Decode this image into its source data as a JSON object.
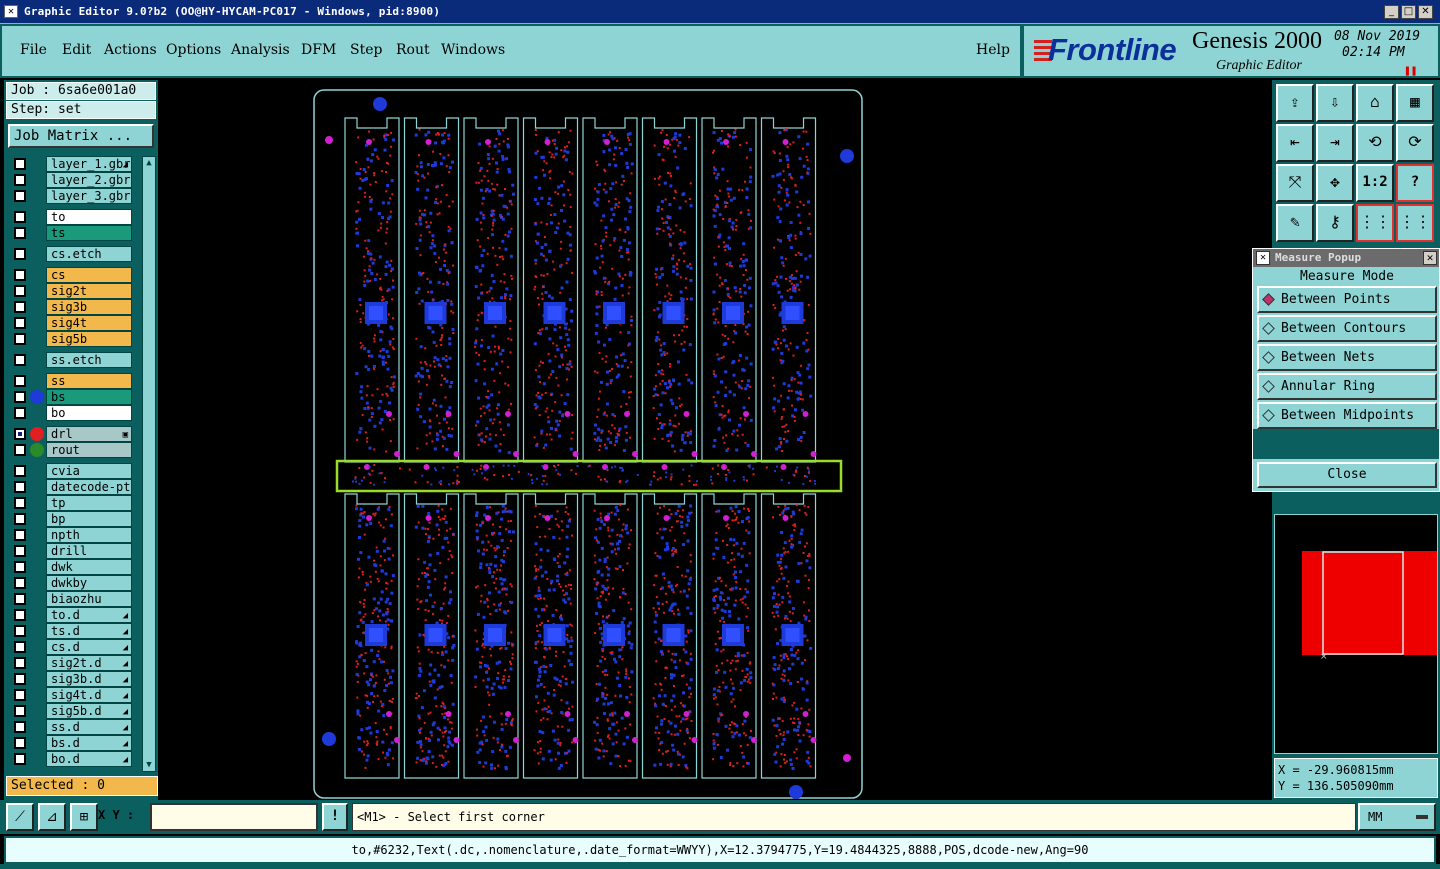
{
  "window": {
    "title": "Graphic Editor 9.0?b2 (OO@HY-HYCAM-PC017 - Windows, pid:8900)"
  },
  "menu": {
    "items": [
      "File",
      "Edit",
      "Actions",
      "Options",
      "Analysis",
      "DFM",
      "Step",
      "Rout",
      "Windows"
    ],
    "help": "Help"
  },
  "brand": {
    "logo": "Frontline",
    "product": "Genesis 2000",
    "subtitle": "Graphic Editor",
    "date": "08 Nov 2019",
    "time": "02:14 PM"
  },
  "job": {
    "job_label": "Job : 6sa6e001a0",
    "step_label": "Step: set",
    "job_matrix_button": "Job Matrix ..."
  },
  "layers": [
    {
      "name": "layer_1.gbr",
      "color": "#8fd4d4",
      "tag": "◢"
    },
    {
      "name": "layer_2.gbr",
      "color": "#8fd4d4",
      "tag": ""
    },
    {
      "name": "layer_3.gbr",
      "color": "#8fd4d4",
      "tag": ""
    },
    {
      "name": "to",
      "color": "#ffffff",
      "tag": ""
    },
    {
      "name": "ts",
      "color": "#1a9a7a",
      "tag": ""
    },
    {
      "name": "cs.etch",
      "color": "#8fd4d4",
      "tag": ""
    },
    {
      "name": "cs",
      "color": "#f2b84c",
      "tag": ""
    },
    {
      "name": "sig2t",
      "color": "#f2b84c",
      "tag": ""
    },
    {
      "name": "sig3b",
      "color": "#f2b84c",
      "tag": ""
    },
    {
      "name": "sig4t",
      "color": "#f2b84c",
      "tag": ""
    },
    {
      "name": "sig5b",
      "color": "#f2b84c",
      "tag": ""
    },
    {
      "name": "ss.etch",
      "color": "#8fd4d4",
      "tag": ""
    },
    {
      "name": "ss",
      "color": "#f2b84c",
      "tag": ""
    },
    {
      "name": "bs",
      "color": "#1a9a7a",
      "tag": "",
      "dot": "#1e3ad8"
    },
    {
      "name": "bo",
      "color": "#ffffff",
      "tag": ""
    },
    {
      "name": "drl",
      "color": "#a8c8c8",
      "tag": "▣",
      "dot": "#e02020",
      "checked": true
    },
    {
      "name": "rout",
      "color": "#a8c8c8",
      "tag": "",
      "dot": "#2a8a2a"
    },
    {
      "name": "cvia",
      "color": "#8fd4d4",
      "tag": ""
    },
    {
      "name": "datecode-ptc",
      "color": "#8fd4d4",
      "tag": ""
    },
    {
      "name": "tp",
      "color": "#8fd4d4",
      "tag": ""
    },
    {
      "name": "bp",
      "color": "#8fd4d4",
      "tag": ""
    },
    {
      "name": "npth",
      "color": "#8fd4d4",
      "tag": ""
    },
    {
      "name": "drill",
      "color": "#8fd4d4",
      "tag": ""
    },
    {
      "name": "dwk",
      "color": "#8fd4d4",
      "tag": ""
    },
    {
      "name": "dwkby",
      "color": "#8fd4d4",
      "tag": ""
    },
    {
      "name": "biaozhu",
      "color": "#8fd4d4",
      "tag": ""
    },
    {
      "name": "to.d",
      "color": "#8fd4d4",
      "tag": "◢"
    },
    {
      "name": "ts.d",
      "color": "#8fd4d4",
      "tag": "◢"
    },
    {
      "name": "cs.d",
      "color": "#8fd4d4",
      "tag": "◢"
    },
    {
      "name": "sig2t.d",
      "color": "#8fd4d4",
      "tag": "◢"
    },
    {
      "name": "sig3b.d",
      "color": "#8fd4d4",
      "tag": "◢"
    },
    {
      "name": "sig4t.d",
      "color": "#8fd4d4",
      "tag": "◢"
    },
    {
      "name": "sig5b.d",
      "color": "#8fd4d4",
      "tag": "◢"
    },
    {
      "name": "ss.d",
      "color": "#8fd4d4",
      "tag": "◢"
    },
    {
      "name": "bs.d",
      "color": "#8fd4d4",
      "tag": "◢"
    },
    {
      "name": "bo.d",
      "color": "#8fd4d4",
      "tag": "◢"
    }
  ],
  "selected": "Selected : 0",
  "tools": {
    "icons": [
      "home-icon",
      "snapshot-icon",
      "house-icon",
      "grid-icon",
      "prev-icon",
      "next-icon",
      "swap-icon",
      "rotate-icon",
      "fit-icon",
      "center-icon",
      "scale-icon",
      "help-icon",
      "pen-icon",
      "key-icon",
      "nets-icon",
      "compare-icon"
    ],
    "scale_label": "1:2",
    "help_label": "?"
  },
  "measure": {
    "title": "Measure Popup",
    "heading": "Measure Mode",
    "options": [
      "Between Points",
      "Between Contours",
      "Between Nets",
      "Annular Ring",
      "Between Midpoints"
    ],
    "selected_index": 0,
    "close_label": "Close"
  },
  "coords": {
    "x": "X = -29.960815mm",
    "y": "Y = 136.505090mm"
  },
  "bottom": {
    "xy_label": "X Y :",
    "xy_value": "",
    "excl": "!",
    "prompt": "<M1> - Select first corner",
    "units": "MM"
  },
  "status": "to,#6232,Text(.dc,.nomenclature,.date_format=WWYY),X=12.3794775,Y=19.4844325,8888,POS,dcode-new,Ang=90",
  "colors": {
    "teal_dark": "#0b5f5f",
    "teal_light": "#8fd4d4",
    "board_outline": "#8fd4d4",
    "pads_blue": "#1e3ad8",
    "pads_red": "#e02020",
    "drill_magenta": "#d020d0",
    "highlight_green": "#9adc2a"
  }
}
